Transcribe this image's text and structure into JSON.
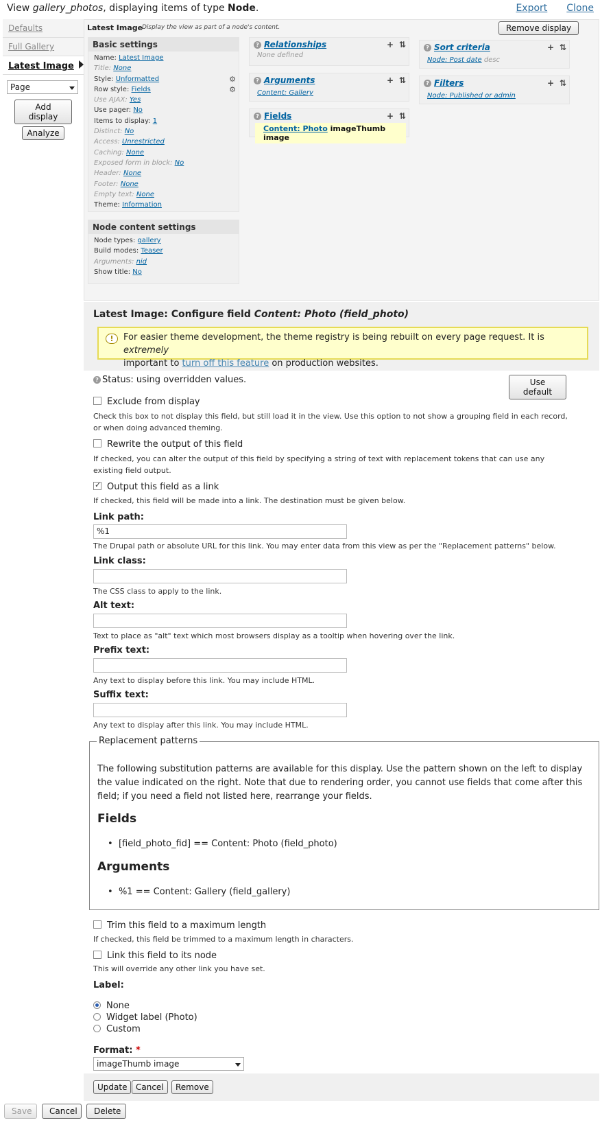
{
  "header": {
    "view_prefix": "View ",
    "view_name": "gallery_photos",
    "view_middle": ", displaying items of type ",
    "view_type": "Node",
    "view_suffix": ".",
    "export": "Export",
    "clone": "Clone"
  },
  "tabs": {
    "defaults": "Defaults",
    "full_gallery": "Full Gallery",
    "latest_image": "Latest Image",
    "display_select": "Page",
    "add_display": "Add display",
    "analyze": "Analyze"
  },
  "display": {
    "title": "Latest Image",
    "description": "Display the view as part of a node's content.",
    "remove_button": "Remove display"
  },
  "basic_settings": {
    "title": "Basic settings",
    "rows": [
      {
        "label": "Name:",
        "value": "Latest Image"
      },
      {
        "label": "Title:",
        "value": "None"
      },
      {
        "label": "Style:",
        "value": "Unformatted"
      },
      {
        "label": "Row style:",
        "value": "Fields"
      },
      {
        "label": "Use AJAX:",
        "value": "Yes"
      },
      {
        "label": "Use pager:",
        "value": "No"
      },
      {
        "label": "Items to display:",
        "value": "1"
      },
      {
        "label": "Distinct:",
        "value": "No"
      },
      {
        "label": "Access:",
        "value": "Unrestricted"
      },
      {
        "label": "Caching:",
        "value": "None"
      },
      {
        "label": "Exposed form in block:",
        "value": "No"
      },
      {
        "label": "Header:",
        "value": "None"
      },
      {
        "label": "Footer:",
        "value": "None"
      },
      {
        "label": "Empty text:",
        "value": "None"
      },
      {
        "label": "Theme:",
        "value": "Information"
      }
    ]
  },
  "node_content": {
    "title": "Node content settings",
    "rows": [
      {
        "label": "Node types:",
        "value": "gallery"
      },
      {
        "label": "Build modes:",
        "value": "Teaser"
      },
      {
        "label": "Arguments:",
        "value": "nid"
      },
      {
        "label": "Show title:",
        "value": "No"
      }
    ]
  },
  "relationships": {
    "title": "Relationships",
    "content": "None defined"
  },
  "arguments": {
    "title": "Arguments",
    "content": "Content: Gallery"
  },
  "fields": {
    "title": "Fields",
    "link": "Content: Photo",
    "rest": " imageThumb image"
  },
  "sort_criteria": {
    "title": "Sort criteria",
    "link": "Node: Post date",
    "rest": " desc"
  },
  "filters": {
    "title": "Filters",
    "content": "Node: Published or admin"
  },
  "configure": {
    "title_prefix": "Latest Image: Configure field ",
    "title_field": "Content: Photo (field_photo)",
    "warning_1": "For easier theme development, the theme registry is being rebuilt on every page request. It is ",
    "warning_em": "extremely",
    "warning_2": "important to ",
    "warning_link": "turn off this feature",
    "warning_3": " on production websites.",
    "status": "Status: using overridden values.",
    "use_default": "Use default",
    "exclude_label": "Exclude from display",
    "exclude_desc": "Check this box to not display this field, but still load it in the view. Use this option to not show a grouping field in each record, or when doing advanced theming.",
    "rewrite_label": "Rewrite the output of this field",
    "rewrite_desc": "If checked, you can alter the output of this field by specifying a string of text with replacement tokens that can use any existing field output.",
    "link_label": "Output this field as a link",
    "link_desc": "If checked, this field will be made into a link. The destination must be given below.",
    "link_path_label": "Link path:",
    "link_path_value": "%1",
    "link_path_desc": "The Drupal path or absolute URL for this link. You may enter data from this view as per the \"Replacement patterns\" below.",
    "link_class_label": "Link class:",
    "link_class_desc": "The CSS class to apply to the link.",
    "alt_label": "Alt text:",
    "alt_desc": "Text to place as \"alt\" text which most browsers display as a tooltip when hovering over the link.",
    "prefix_label": "Prefix text:",
    "prefix_desc": "Any text to display before this link. You may include HTML.",
    "suffix_label": "Suffix text:",
    "suffix_desc": "Any text to display after this link. You may include HTML.",
    "patterns_legend": "Replacement patterns",
    "patterns_desc": "The following substitution patterns are available for this display. Use the pattern shown on the left to display the value indicated on the right. Note that due to rendering order, you cannot use fields that come after this field; if you need a field not listed here, rearrange your fields.",
    "patterns_fields_h": "Fields",
    "patterns_fields_item": "[field_photo_fid] == Content: Photo (field_photo)",
    "patterns_args_h": "Arguments",
    "patterns_args_item": "%1 == Content: Gallery (field_gallery)",
    "trim_label": "Trim this field to a maximum length",
    "trim_desc": "If checked, this field be trimmed to a maximum length in characters.",
    "linknode_label": "Link this field to its node",
    "linknode_desc": "This will override any other link you have set.",
    "label_label": "Label:",
    "radio_none": "None",
    "radio_widget": "Widget label (Photo)",
    "radio_custom": "Custom",
    "format_label": "Format:",
    "format_required": "*",
    "format_value": "imageThumb image",
    "update": "Update",
    "cancel": "Cancel",
    "remove": "Remove"
  },
  "footer": {
    "save": "Save",
    "cancel": "Cancel",
    "delete": "Delete"
  }
}
